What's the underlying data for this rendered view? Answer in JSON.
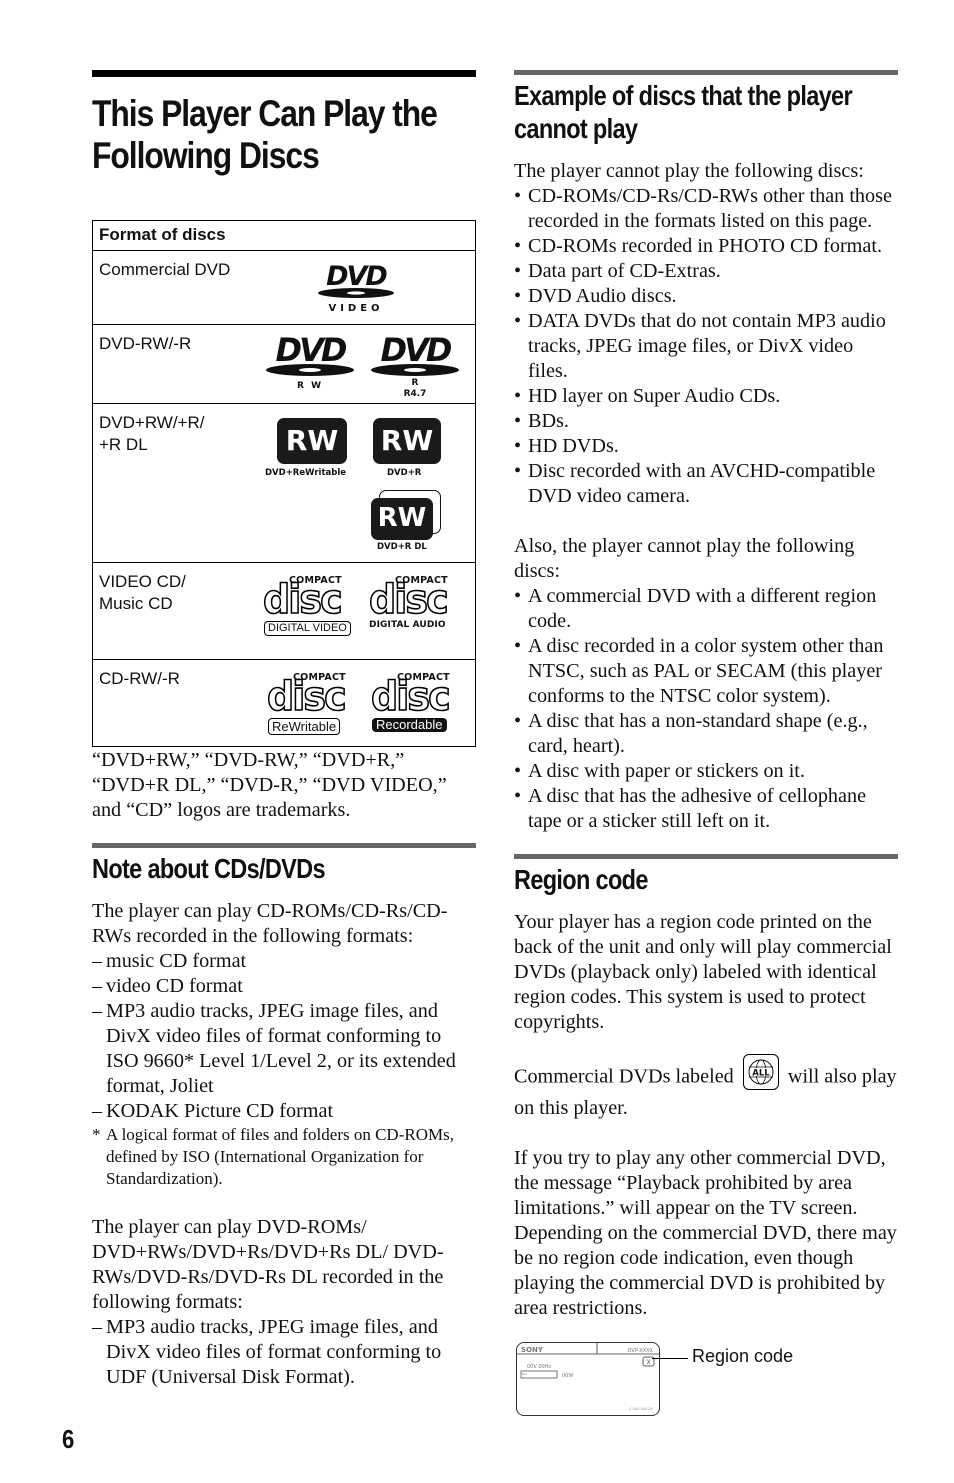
{
  "left": {
    "title": "This Player Can Play the Following Discs",
    "table": {
      "header": "Format of discs",
      "rows": [
        {
          "format": "Commercial DVD",
          "logos": [
            {
              "icon": "dvd-video-logo",
              "caption": "VIDEO"
            }
          ]
        },
        {
          "format": "DVD-RW/-R",
          "logos": [
            {
              "icon": "dvd-rw-logo",
              "caption": "R W"
            },
            {
              "icon": "dvd-r-logo",
              "caption": "R",
              "caption2": "R4.7"
            }
          ]
        },
        {
          "format_line1": "DVD+RW/+R/",
          "format_line2": "+R DL",
          "logos": [
            {
              "icon": "dvd-plus-rw-logo",
              "mark": "RW",
              "caption": "DVD+ReWritable"
            },
            {
              "icon": "dvd-plus-r-logo",
              "mark": "RW",
              "caption": "DVD+R"
            },
            {
              "icon": "dvd-plus-r-dl-logo",
              "mark": "RW",
              "caption": "DVD+R DL"
            }
          ]
        },
        {
          "format_line1": "VIDEO CD/",
          "format_line2": "Music CD",
          "logos": [
            {
              "icon": "compact-disc-digital-video-logo",
              "top": "COMPACT",
              "word": "disc",
              "caption": "DIGITAL VIDEO"
            },
            {
              "icon": "compact-disc-digital-audio-logo",
              "top": "COMPACT",
              "word": "disc",
              "caption": "DIGITAL AUDIO"
            }
          ]
        },
        {
          "format": "CD-RW/-R",
          "logos": [
            {
              "icon": "compact-disc-rewritable-logo",
              "top": "COMPACT",
              "word": "disc",
              "caption": "ReWritable"
            },
            {
              "icon": "compact-disc-recordable-logo",
              "top": "COMPACT",
              "word": "disc",
              "caption": "Recordable"
            }
          ]
        }
      ]
    },
    "trademark_note": "“DVD+RW,” “DVD-RW,” “DVD+R,” “DVD+R DL,” “DVD-R,” “DVD VIDEO,” and “CD” logos are trademarks.",
    "note_section": {
      "heading": "Note about CDs/DVDs",
      "cd_intro": "The player can play CD-ROMs/CD-Rs/CD-RWs recorded in the following formats:",
      "cd_formats": [
        "music CD format",
        "video CD format",
        "MP3 audio tracks, JPEG image files, and DivX video files of format conforming to ISO 9660* Level 1/Level 2, or its extended format, Joliet",
        "KODAK Picture CD format"
      ],
      "footnote_marker": "*",
      "footnote": "A logical format of files and folders on CD-ROMs, defined by ISO (International Organization for Standardization).",
      "dvd_intro": "The player can play DVD-ROMs/ DVD+RWs/DVD+Rs/DVD+Rs DL/ DVD-RWs/DVD-Rs/DVD-Rs DL recorded in the following formats:",
      "dvd_formats": [
        "MP3 audio tracks, JPEG image files, and DivX video files of format conforming to UDF (Universal Disk Format)."
      ]
    }
  },
  "right": {
    "cannot_play": {
      "heading": "Example of discs that the player cannot play",
      "intro": "The player cannot play the following discs:",
      "items": [
        "CD-ROMs/CD-Rs/CD-RWs other than those recorded in the formats listed on this page.",
        "CD-ROMs recorded in PHOTO CD format.",
        "Data part of CD-Extras.",
        "DVD Audio discs.",
        "DATA DVDs that do not contain MP3 audio tracks, JPEG image files, or DivX video files.",
        "HD layer on Super Audio CDs.",
        "BDs.",
        "HD DVDs.",
        "Disc recorded with an AVCHD-compatible DVD video camera."
      ],
      "also_intro": "Also, the player cannot play the following discs:",
      "also_items": [
        "A commercial DVD with a different region code.",
        "A disc recorded in a color system other than NTSC, such as PAL or SECAM (this player conforms to the NTSC color system).",
        "A disc that has a non-standard shape (e.g., card, heart).",
        "A disc with paper or stickers on it.",
        "A disc that has the adhesive of cellophane tape or a sticker still left on it."
      ]
    },
    "region": {
      "heading": "Region code",
      "para1": "Your player has a region code printed on the back of the unit and only will play commercial DVDs (playback only) labeled with identical region codes. This system is used to protect copyrights.",
      "para2_before": "Commercial DVDs labeled",
      "all_icon_text": "ALL",
      "para2_after": "will also play on this player.",
      "para3": "If you try to play any other commercial DVD, the message “Playback prohibited by area limitations.” will appear on the TV screen. Depending on the commercial DVD, there may be no region code indication, even though playing the commercial DVD is prohibited by area restrictions.",
      "diagram": {
        "brand": "SONY",
        "model": "DVP-XXXX",
        "voltage": "00V 00Hz",
        "no_label": "NO.",
        "wattage": "00W",
        "region_mark": "X",
        "serial": "0-000-000-00",
        "callout": "Region code"
      }
    }
  },
  "page_number": "6"
}
